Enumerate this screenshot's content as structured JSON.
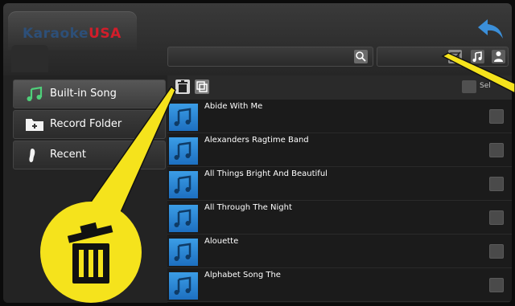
{
  "brand": {
    "part1": "Karaoke",
    "part2": "USA"
  },
  "colors": {
    "accent_blue": "#1f7ad1",
    "highlight_yellow": "#f5e31c",
    "brand_red": "#d21d2a"
  },
  "header": {
    "back_icon": "back-arrow-icon"
  },
  "search": {
    "placeholder": "",
    "icon": "search-icon"
  },
  "filter_icons": [
    "checkbox-icon",
    "music-note-icon",
    "person-icon"
  ],
  "sidebar": {
    "items": [
      {
        "label": "Built-in Song",
        "icon": "music-note-icon",
        "active": true
      },
      {
        "label": "Record Folder",
        "icon": "folder-add-icon",
        "active": false
      },
      {
        "label": "Recent",
        "icon": "footprint-icon",
        "active": false
      }
    ]
  },
  "toolbar": {
    "delete_icon": "trash-icon",
    "copy_icon": "copy-icon",
    "select_all_label": "Sel"
  },
  "songs": [
    {
      "title": "Abide With Me"
    },
    {
      "title": "Alexanders Ragtime Band"
    },
    {
      "title": "All Things Bright And Beautiful"
    },
    {
      "title": "All Through The Night"
    },
    {
      "title": "Alouette"
    },
    {
      "title": "Alphabet Song The"
    }
  ]
}
